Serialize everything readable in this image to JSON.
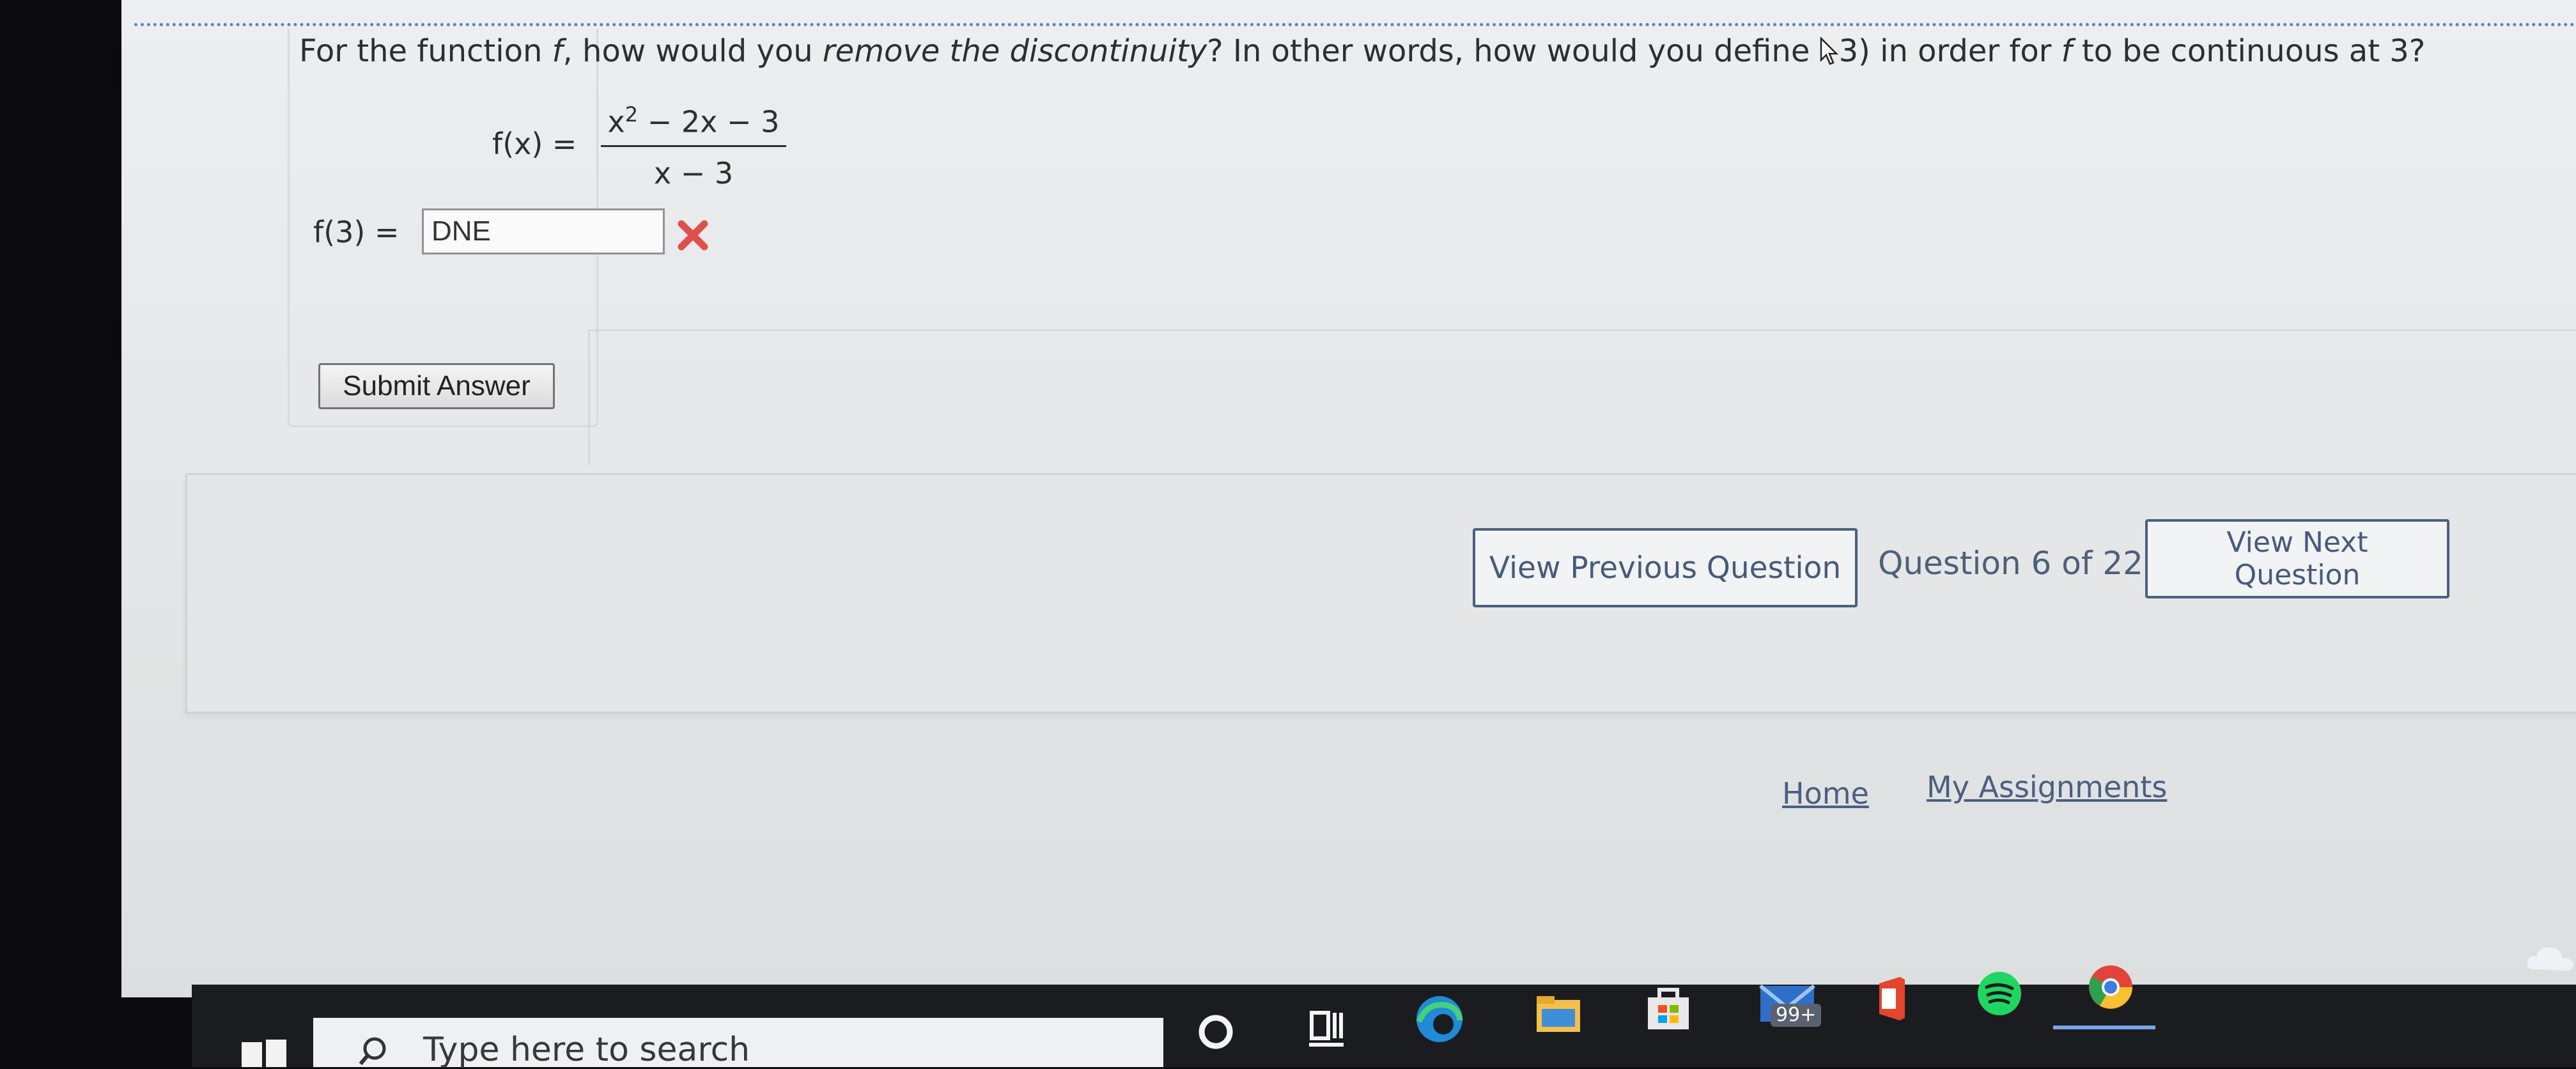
{
  "question": {
    "prompt_parts": {
      "p1": "For the function ",
      "f_var": "f",
      "p2": ", how would you ",
      "emph": "remove the discontinuity",
      "p3": "? In other words, how would you define ",
      "p4": "3) in order for ",
      "f_var2": "f",
      "p5": " to be continuous at 3?"
    },
    "formula": {
      "lhs": "f(x) =",
      "numerator_base": "x",
      "numerator_exp": "2",
      "numerator_rest": " − 2x − 3",
      "denominator": "x − 3"
    },
    "answer": {
      "label": "f(3) =",
      "value": "DNE",
      "status": "incorrect"
    },
    "submit_label": "Submit Answer"
  },
  "navigation": {
    "prev_label": "View Previous Question",
    "counter": "Question 6 of 22",
    "next_label": "View Next Question"
  },
  "footer": {
    "home_label": "Home",
    "assignments_label": "My Assignments"
  },
  "taskbar": {
    "search_placeholder": "Type here to search",
    "mail_badge": "99+",
    "icons": [
      "windows-logo",
      "search-icon",
      "cortana-icon",
      "task-view-icon",
      "edge-icon",
      "file-explorer-icon",
      "store-icon",
      "mail-icon",
      "office-icon",
      "spotify-icon",
      "chrome-icon"
    ]
  },
  "colors": {
    "incorrect": "#e0504a",
    "link": "#4b5f80",
    "nav_border": "#4b5f7e",
    "accent_dotline": "#5a7fd0"
  }
}
